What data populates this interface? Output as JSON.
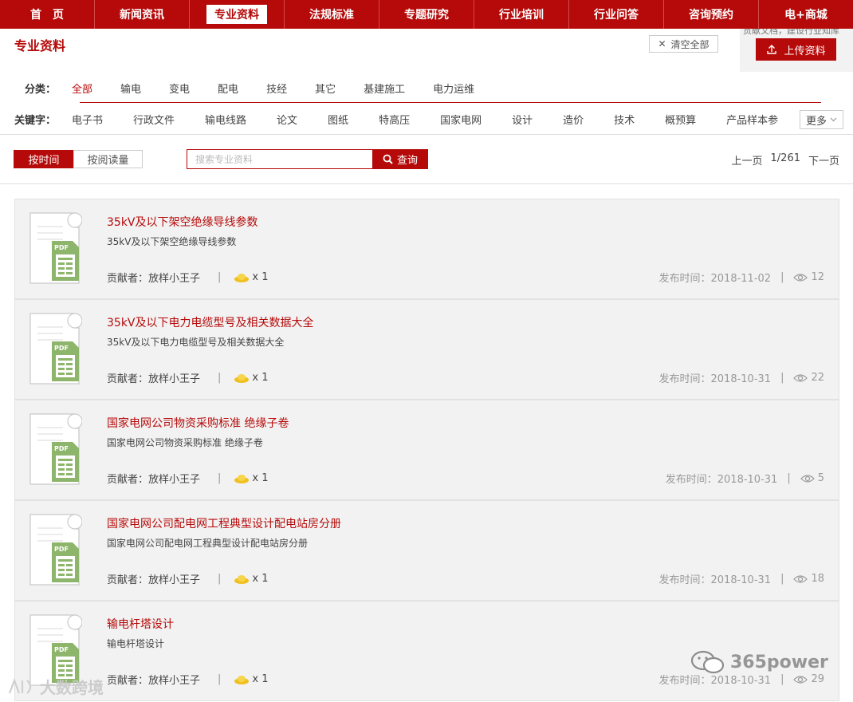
{
  "nav": {
    "items": [
      "首　页",
      "新闻资讯",
      "专业资料",
      "法规标准",
      "专题研究",
      "行业培训",
      "行业问答",
      "咨询预约",
      "电+商城"
    ],
    "active_index": 2
  },
  "header": {
    "page_title": "专业资料",
    "clear_label": "清空全部",
    "hint_text": "贡献文档，建设行业知库",
    "upload_label": "上传资料"
  },
  "filters": {
    "category_label": "分类：",
    "categories": [
      "全部",
      "输电",
      "变电",
      "配电",
      "技经",
      "其它",
      "基建施工",
      "电力运维"
    ],
    "keyword_label": "关键字：",
    "keywords": [
      "电子书",
      "行政文件",
      "输电线路",
      "论文",
      "图纸",
      "特高压",
      "国家电网",
      "设计",
      "造价",
      "技术",
      "概预算",
      "产品样本参"
    ],
    "more_label": "更多"
  },
  "toolbar": {
    "sort_time": "按时间",
    "sort_read": "按阅读量",
    "search_placeholder": "搜索专业资料",
    "search_label": "查询",
    "prev_label": "上一页",
    "page_info": "1/261",
    "next_label": "下一页"
  },
  "list": [
    {
      "title": "35kV及以下架空绝缘导线参数",
      "desc": "35kV及以下架空绝缘导线参数",
      "contributor": "贡献者：放样小王子",
      "coin": "x 1",
      "date": "发布时间：2018-11-02",
      "views": "12"
    },
    {
      "title": "35kV及以下电力电缆型号及相关数据大全",
      "desc": "35kV及以下电力电缆型号及相关数据大全",
      "contributor": "贡献者：放样小王子",
      "coin": "x 1",
      "date": "发布时间：2018-10-31",
      "views": "22"
    },
    {
      "title": "国家电网公司物资采购标准 绝缘子卷",
      "desc": "国家电网公司物资采购标准 绝缘子卷",
      "contributor": "贡献者：放样小王子",
      "coin": "x 1",
      "date": "发布时间：2018-10-31",
      "views": "5"
    },
    {
      "title": "国家电网公司配电网工程典型设计配电站房分册",
      "desc": "国家电网公司配电网工程典型设计配电站房分册",
      "contributor": "贡献者：放样小王子",
      "coin": "x 1",
      "date": "发布时间：2018-10-31",
      "views": "18"
    },
    {
      "title": "输电杆塔设计",
      "desc": "输电杆塔设计",
      "contributor": "贡献者：放样小王子",
      "coin": "x 1",
      "date": "发布时间：2018-10-31",
      "views": "29"
    }
  ],
  "icons": {
    "doc": "pdf-document-icon",
    "coin": "gold-ingot-icon",
    "views": "eye-icon",
    "search": "search-icon",
    "upload": "upload-icon",
    "clear": "close-icon"
  },
  "colors": {
    "brand": "#b60a0a",
    "card_bg": "#f2f2f2",
    "pdf_green": "#8db56b"
  },
  "watermark": {
    "brand1": "365power",
    "brand2": "大数跨境"
  }
}
